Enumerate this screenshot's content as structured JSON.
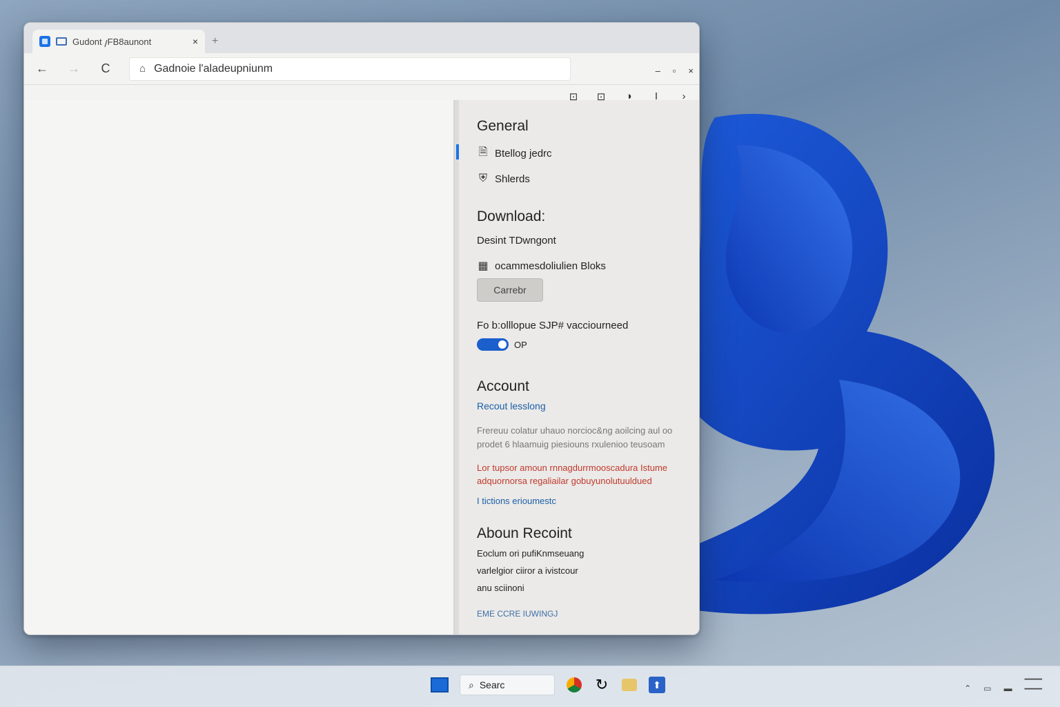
{
  "tab": {
    "title": "Gudont 𐑢FB8aunont",
    "close": "×",
    "new_tab": "+"
  },
  "window_controls": {
    "minimize": "–",
    "maximize": "▫",
    "close": "×"
  },
  "toolbar": {
    "back": "←",
    "forward": "→",
    "reload": "C",
    "url": "Gadnoie l'aladeupniunm"
  },
  "extensions": [
    "⊡",
    "⊡",
    "◑",
    "I",
    "›"
  ],
  "panel": {
    "general": {
      "heading": "General",
      "items": [
        {
          "icon": "document-icon",
          "glyph": "🗎",
          "label": "Btellog jedrc"
        },
        {
          "icon": "shield-icon",
          "glyph": "⛨",
          "label": "Shlerds"
        }
      ]
    },
    "download": {
      "heading": "Download:",
      "label": "Desint TDwngont",
      "item": {
        "icon": "grid-icon",
        "glyph": "▦",
        "label": "ocammesdoliulien Bloks"
      },
      "button": "Carrebr",
      "option": "Fo b:olllopue SJP# vacciourneed",
      "toggle": {
        "track_label": "on",
        "state_label": "OP"
      }
    },
    "account": {
      "heading": "Account",
      "link": "Recout lesslong",
      "muted": [
        "Frereuu colatur uhauo norcioc&ng aoilcing aul oo",
        "prodet 6 hlaamuig piesiouns rxulenioo teusoam"
      ],
      "warning": [
        "Lor tupsor amoun rnnagdurrmooscadura Istume",
        "adquornorsa regaliailar gobuyunolutuuldued"
      ],
      "link2": "I tictions erioumestc"
    },
    "about": {
      "heading": "Aboun Recoint",
      "lines": [
        "Eoclum ori pufiKnmseuang",
        "varlelgior ciiror a ivistcour",
        "anu sciinoni"
      ],
      "version": "EME CCRE IUWINGJ"
    }
  },
  "taskbar": {
    "search": "Searc",
    "app_icon_glyph": "⬆"
  },
  "colors": {
    "accent": "#1a73e8",
    "warning": "#c0392b",
    "link": "#1a5fa8"
  }
}
